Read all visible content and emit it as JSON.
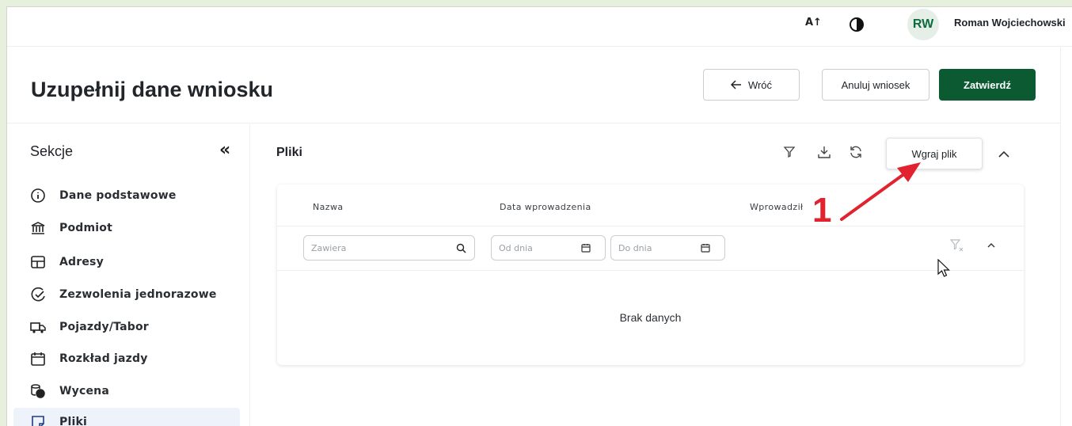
{
  "topbar": {
    "font_size_label": "A↑",
    "avatar_initials": "RW",
    "user_name": "Roman Wojciechowski"
  },
  "header": {
    "title": "Uzupełnij dane wniosku",
    "back_label": "Wróć",
    "cancel_label": "Anuluj wniosek",
    "confirm_label": "Zatwierdź"
  },
  "sidebar": {
    "title": "Sekcje",
    "collapse_glyph": "«",
    "items": [
      {
        "label": "Dane podstawowe",
        "icon": "info-icon"
      },
      {
        "label": "Podmiot",
        "icon": "bank-icon"
      },
      {
        "label": "Adresy",
        "icon": "address-icon"
      },
      {
        "label": "Zezwolenia jednorazowe",
        "icon": "permit-icon"
      },
      {
        "label": "Pojazdy/Tabor",
        "icon": "truck-icon"
      },
      {
        "label": "Rozkład jazdy",
        "icon": "calendar-icon"
      },
      {
        "label": "Wycena",
        "icon": "coins-icon"
      },
      {
        "label": "Pliki",
        "icon": "file-icon",
        "active": true
      }
    ]
  },
  "main": {
    "title": "Pliki",
    "upload_label": "Wgraj plik",
    "table": {
      "columns": [
        "Nazwa",
        "Data wprowadzenia",
        "Wprowadził"
      ],
      "filters": {
        "name_placeholder": "Zawiera",
        "date_from_placeholder": "Od dnia",
        "date_to_placeholder": "Do dnia"
      },
      "empty_text": "Brak danych"
    }
  },
  "annotation": {
    "number": "1",
    "color": "#e0232e"
  },
  "colors": {
    "accent": "#0b5a31",
    "avatar_bg": "#e5efe7"
  }
}
